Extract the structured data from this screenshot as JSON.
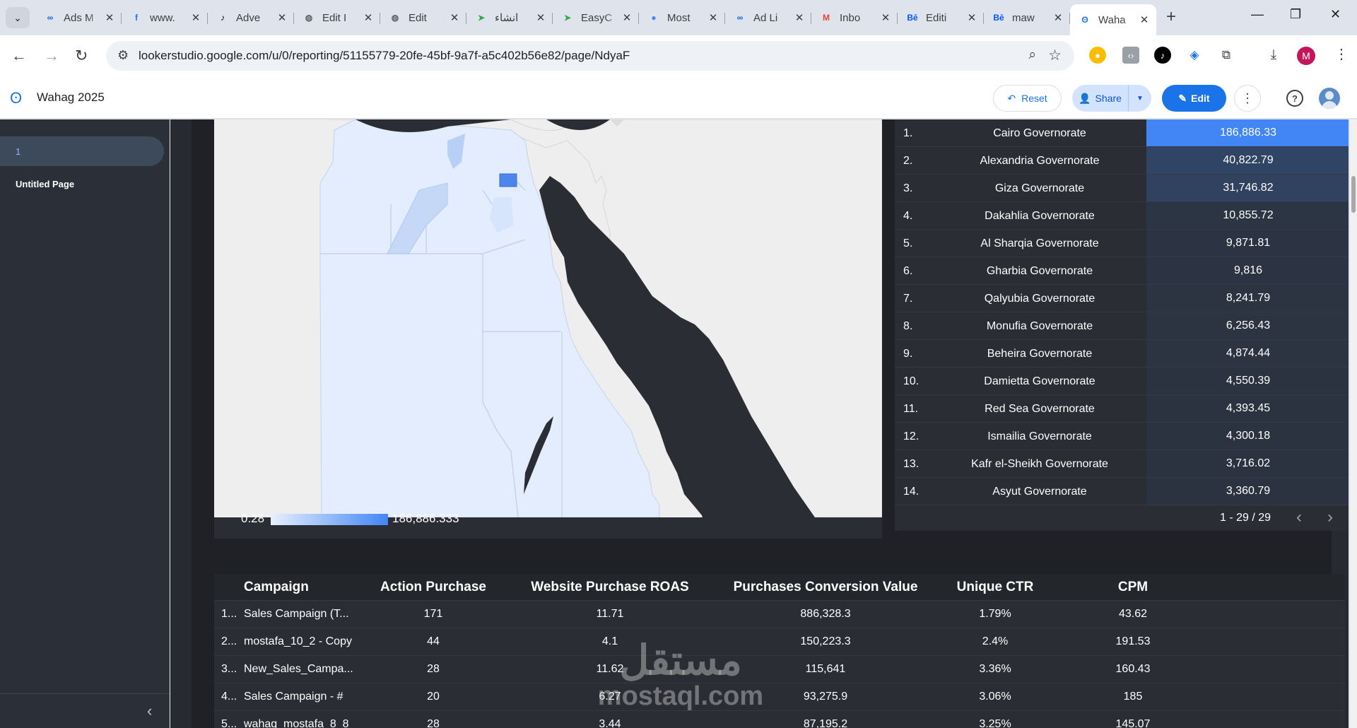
{
  "browser": {
    "tabs": [
      {
        "title": "Ads M",
        "icon": "meta-icon",
        "fav": "∞",
        "color": "#0668e1"
      },
      {
        "title": "www.",
        "icon": "facebook-icon",
        "fav": "f",
        "color": "#1877f2"
      },
      {
        "title": "Adve",
        "icon": "tiktok-icon",
        "fav": "♪",
        "color": "#000000"
      },
      {
        "title": "Edit I",
        "icon": "globe-icon",
        "fav": "◍",
        "color": "#5f6368"
      },
      {
        "title": "Edit",
        "icon": "globe-icon",
        "fav": "◍",
        "color": "#5f6368"
      },
      {
        "title": "انشاء",
        "icon": "send-arrow-icon",
        "fav": "➤",
        "color": "#34a853"
      },
      {
        "title": "EasyC",
        "icon": "send-arrow-icon",
        "fav": "➤",
        "color": "#34a853"
      },
      {
        "title": "Most",
        "icon": "circle-app-icon",
        "fav": "●",
        "color": "#4285f4"
      },
      {
        "title": "Ad Li",
        "icon": "meta-icon",
        "fav": "∞",
        "color": "#0668e1"
      },
      {
        "title": "Inbo",
        "icon": "gmail-icon",
        "fav": "M",
        "color": "#ea4335"
      },
      {
        "title": "Editi",
        "icon": "behance-icon",
        "fav": "Bē",
        "color": "#0057ff"
      },
      {
        "title": "maw",
        "icon": "behance-icon",
        "fav": "Bē",
        "color": "#0057ff"
      },
      {
        "title": "Waha",
        "icon": "looker-studio-icon",
        "fav": "ʘ",
        "color": "#1a73e8",
        "active": true
      }
    ],
    "url": "lookerstudio.google.com/u/0/reporting/51155779-20fe-45bf-9a7f-a5c402b56e82/page/NdyaF",
    "profile_initial": "M"
  },
  "report": {
    "title": "Wahag 2025",
    "reset_label": "Reset",
    "share_label": "Share",
    "edit_label": "Edit"
  },
  "sidebar": {
    "pages": [
      {
        "label": "1",
        "active": true
      },
      {
        "label": "Untitled Page",
        "active": false
      }
    ]
  },
  "map": {
    "legend_min": "0.28",
    "legend_max": "186,886.333"
  },
  "geo_table": {
    "rows": [
      {
        "idx": "1.",
        "name": "Cairo Governorate",
        "value": "186,886.33",
        "heat": 1.0
      },
      {
        "idx": "2.",
        "name": "Alexandria Governorate",
        "value": "40,822.79",
        "heat": 0.22
      },
      {
        "idx": "3.",
        "name": "Giza Governorate",
        "value": "31,746.82",
        "heat": 0.17
      },
      {
        "idx": "4.",
        "name": "Dakahlia Governorate",
        "value": "10,855.72",
        "heat": 0.06
      },
      {
        "idx": "5.",
        "name": "Al Sharqia Governorate",
        "value": "9,871.81",
        "heat": 0.05
      },
      {
        "idx": "6.",
        "name": "Gharbia Governorate",
        "value": "9,816",
        "heat": 0.05
      },
      {
        "idx": "7.",
        "name": "Qalyubia Governorate",
        "value": "8,241.79",
        "heat": 0.04
      },
      {
        "idx": "8.",
        "name": "Monufia Governorate",
        "value": "6,256.43",
        "heat": 0.03
      },
      {
        "idx": "9.",
        "name": "Beheira Governorate",
        "value": "4,874.44",
        "heat": 0.03
      },
      {
        "idx": "10.",
        "name": "Damietta Governorate",
        "value": "4,550.39",
        "heat": 0.02
      },
      {
        "idx": "11.",
        "name": "Red Sea Governorate",
        "value": "4,393.45",
        "heat": 0.02
      },
      {
        "idx": "12.",
        "name": "Ismailia Governorate",
        "value": "4,300.18",
        "heat": 0.02
      },
      {
        "idx": "13.",
        "name": "Kafr el-Sheikh Governorate",
        "value": "3,716.02",
        "heat": 0.02
      },
      {
        "idx": "14.",
        "name": "Asyut Governorate",
        "value": "3,360.79",
        "heat": 0.02
      }
    ],
    "pagination": "1 - 29 / 29"
  },
  "campaign_table": {
    "headers": [
      "Campaign",
      "Action Purchase",
      "Website Purchase ROAS",
      "Purchases Conversion Value",
      "Unique CTR",
      "CPM"
    ],
    "rows": [
      {
        "idx": "1...",
        "campaign": "Sales Campaign (T...",
        "action_purchase": "171",
        "roas": "11.71",
        "conv_value": "886,328.3",
        "ctr": "1.79%",
        "cpm": "43.62"
      },
      {
        "idx": "2...",
        "campaign": "mostafa_10_2 - Copy",
        "action_purchase": "44",
        "roas": "4.1",
        "conv_value": "150,223.3",
        "ctr": "2.4%",
        "cpm": "191.53"
      },
      {
        "idx": "3...",
        "campaign": "New_Sales_Campa...",
        "action_purchase": "28",
        "roas": "11.62",
        "conv_value": "115,641",
        "ctr": "3.36%",
        "cpm": "160.43"
      },
      {
        "idx": "4...",
        "campaign": "Sales Campaign - #",
        "action_purchase": "20",
        "roas": "6.27",
        "conv_value": "93,275.9",
        "ctr": "3.06%",
        "cpm": "185"
      },
      {
        "idx": "5...",
        "campaign": "wahag_mostafa_8_8",
        "action_purchase": "28",
        "roas": "3.44",
        "conv_value": "87,195.2",
        "ctr": "3.25%",
        "cpm": "145.07"
      }
    ]
  },
  "watermark": {
    "arabic": "مستقل",
    "latin": "mostaql.com"
  }
}
